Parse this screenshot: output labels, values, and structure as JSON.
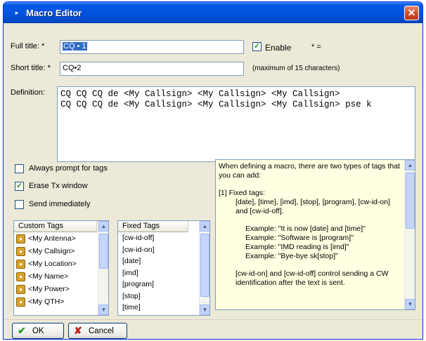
{
  "window": {
    "title": "Macro Editor"
  },
  "form": {
    "full_title_label": "Full title: *",
    "full_title_value": "CQ • 1",
    "short_title_label": "Short title: *",
    "short_title_value": "CQ•2",
    "enable_label": "Enable",
    "enable_checked": true,
    "enable_note": "* =",
    "short_title_hint": "(maximum of 15 characters)",
    "definition_label": "Definition:",
    "definition_lines": [
      "CQ CQ CQ de <My Callsign> <My Callsign> <My Callsign>",
      "CQ CQ CQ de <My Callsign> <My Callsign> <My Callsign> pse k"
    ]
  },
  "options": [
    {
      "label": "Always prompt for tags",
      "checked": false
    },
    {
      "label": "Erase Tx window",
      "checked": true
    },
    {
      "label": "Send immediately",
      "checked": false
    }
  ],
  "custom_tags": {
    "header": "Custom Tags",
    "items": [
      "<My Antenna>",
      "<My Callsign>",
      "<My Location>",
      "<My Name>",
      "<My Power>",
      "<My QTH>"
    ]
  },
  "fixed_tags": {
    "header": "Fixed Tags",
    "items": [
      "[cw-id-off]",
      "[cw-id-on]",
      "[date]",
      "[imd]",
      "[program]",
      "[stop]",
      "[time]"
    ]
  },
  "help": {
    "intro": "When defining a macro, there are two types of tags that you can add:",
    "fixed_heading": "[1] Fixed tags:",
    "fixed_desc": "[date], [time], [imd], [stop], [program], [cw-id-on] and [cw-id-off].",
    "examples": [
      "Example: \"It is now [date] and [time]\"",
      "Example: \"Software is [program]\"",
      "Example: \"IMD reading is [imd]\"",
      "Example: \"Bye-bye sk[stop]\""
    ],
    "cwid_desc": "[cw-id-on] and [cw-id-off] control sending a CW identification after the text is sent."
  },
  "buttons": {
    "ok": "OK",
    "cancel": "Cancel"
  },
  "colors": {
    "titlebar": "#0054e3",
    "window_bg": "#ece9d8",
    "help_bg": "#ffffe1",
    "selection": "#316ac5"
  }
}
